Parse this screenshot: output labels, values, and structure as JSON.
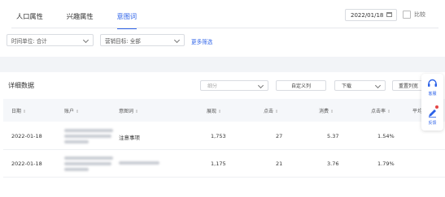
{
  "tabs": [
    {
      "label": "人口属性",
      "active": false
    },
    {
      "label": "兴趣属性",
      "active": false
    },
    {
      "label": "意图词",
      "active": true
    }
  ],
  "date": "2022/01/18",
  "compare_label": "比较",
  "filters": {
    "time_unit": "时间单位: 合计",
    "goal": "营销目标: 全部",
    "more": "更多筛选"
  },
  "table": {
    "title": "详细数据",
    "group_placeholder": "细分",
    "custom_columns": "自定义列",
    "download": "下载",
    "reset_columns": "重置列宽",
    "columns": [
      "日期",
      "账户",
      "意图词",
      "展现",
      "点击",
      "消费",
      "点击率",
      "平均"
    ],
    "rows": [
      {
        "date": "2022-01-18",
        "intent": "注意事项",
        "impressions": "1,753",
        "clicks": "27",
        "cost": "5.37",
        "ctr": "1.54%"
      },
      {
        "date": "2022-01-18",
        "intent": "",
        "impressions": "1,175",
        "clicks": "21",
        "cost": "3.76",
        "ctr": "1.79%"
      }
    ]
  },
  "float_menu": {
    "consult": "客服",
    "feedback": "反馈"
  },
  "colors": {
    "accent": "#2c62e8",
    "badge": "#e54545"
  }
}
